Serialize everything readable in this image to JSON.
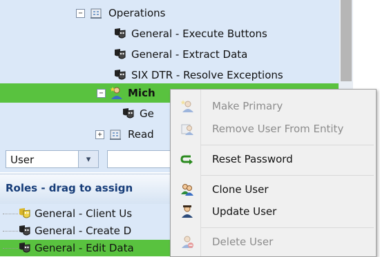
{
  "tree": {
    "nodes": [
      {
        "id": "operations",
        "label": "Operations",
        "expander": "−"
      },
      {
        "id": "gen-exec",
        "label": "General - Execute Buttons"
      },
      {
        "id": "gen-extract",
        "label": "General - Extract Data"
      },
      {
        "id": "six-dtr",
        "label": "SIX DTR - Resolve Exceptions"
      },
      {
        "id": "mich",
        "label": "Mich",
        "expander": "−"
      },
      {
        "id": "ge",
        "label": "Ge"
      },
      {
        "id": "read",
        "label": "Read",
        "expander": "+"
      }
    ]
  },
  "search": {
    "type_value": "User",
    "type_arrow": "▾",
    "text_value": ""
  },
  "roles": {
    "header": "Roles - drag to assign",
    "items": [
      {
        "label": "General - Client Us"
      },
      {
        "label": "General - Create D"
      },
      {
        "label": "General - Edit Data"
      }
    ]
  },
  "context_menu": {
    "items": [
      {
        "label": "Make Primary",
        "enabled": false,
        "icon": "user-star-icon"
      },
      {
        "label": "Remove User From Entity",
        "enabled": false,
        "icon": "remove-user-icon"
      },
      {
        "label": "Reset Password",
        "enabled": true,
        "icon": "reset-arrow-icon"
      },
      {
        "label": "Clone User",
        "enabled": true,
        "icon": "clone-user-icon"
      },
      {
        "label": "Update User",
        "enabled": true,
        "icon": "update-user-icon"
      },
      {
        "label": "Delete User",
        "enabled": false,
        "icon": "delete-user-icon"
      }
    ]
  },
  "colors": {
    "selection": "#59c23f",
    "panel": "#dbe8f8",
    "header_text": "#163c78"
  }
}
